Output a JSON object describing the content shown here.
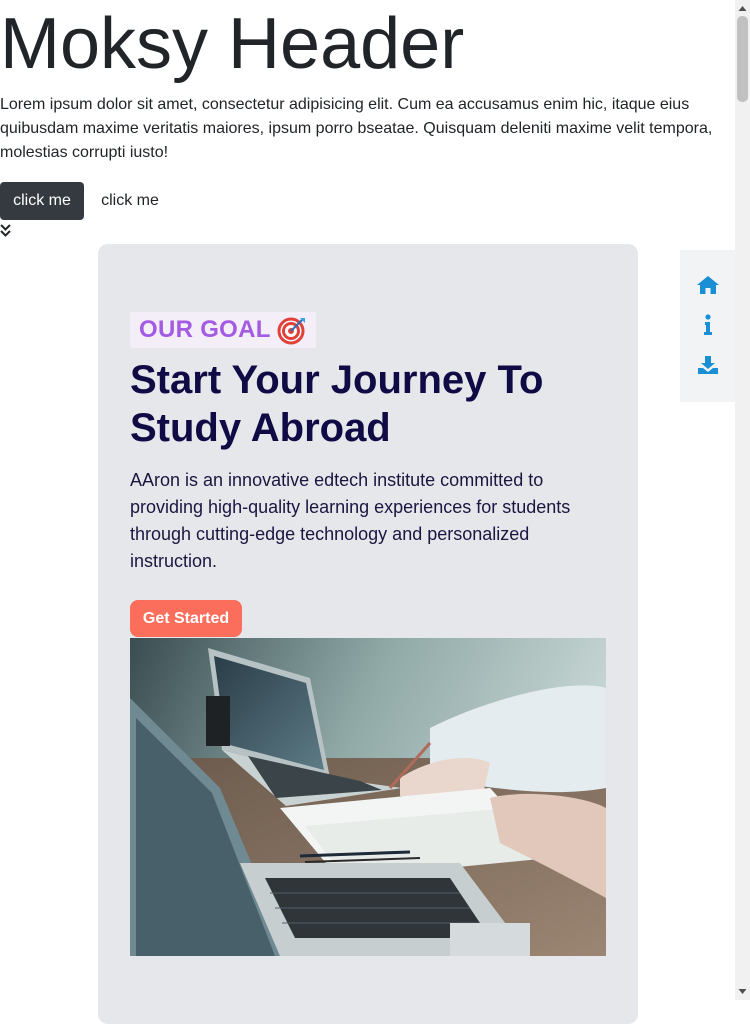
{
  "header": {
    "title": "Moksy Header",
    "text": "Lorem ipsum dolor sit amet, consectetur adipisicing elit. Cum ea accusamus enim hic, itaque eius quibusdam maxime veritatis maiores, ipsum porro bseatae. Quisquam deleniti maxime velit tempora, molestias corrupti iusto!",
    "primary_button": "click me",
    "secondary_button": "click me"
  },
  "hero": {
    "badge": "OUR GOAL",
    "badge_icon": "target-icon",
    "title": "Start Your Journey To Study Abroad",
    "description": "AAron is an innovative edtech institute committed to providing high-quality learning experiences for students through cutting-edge technology and personalized instruction.",
    "cta": "Get Started",
    "image": "photo of two laptops on a desk with a person writing on paper"
  },
  "side_nav": {
    "items": [
      {
        "icon": "home-icon"
      },
      {
        "icon": "info-icon"
      },
      {
        "icon": "download-icon"
      }
    ]
  },
  "colors": {
    "badge_text": "#a35be3",
    "title": "#100a45",
    "cta": "#fb6e5c",
    "card_bg": "#e5e7eb",
    "nav_icon": "#1a8fd6",
    "dark_button": "#343a40"
  }
}
